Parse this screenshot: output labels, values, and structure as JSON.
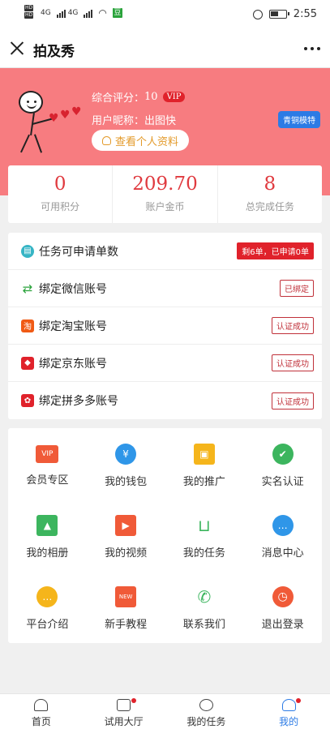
{
  "status_bar": {
    "time": "2:55",
    "hd1": "HD",
    "hd2": "HD",
    "net1": "4G",
    "net2": "4G",
    "app_icon": "豆"
  },
  "title_bar": {
    "title": "拍及秀"
  },
  "profile": {
    "score_label": "综合评分：",
    "score_value": "10",
    "vip_badge": "VIP",
    "nickname_label": "用户昵称：",
    "nickname_value": "出图快",
    "view_profile_label": "查看个人资料",
    "level_badge": "青铜模特"
  },
  "stats": [
    {
      "value": "0",
      "label": "可用积分"
    },
    {
      "value": "209.70",
      "label": "账户金币"
    },
    {
      "value": "8",
      "label": "总完成任务"
    }
  ],
  "accounts": [
    {
      "label": "任务可申请单数",
      "tag": "剩6单，已申请0单",
      "icon": "clipboard-icon",
      "color": "#36b5c5"
    },
    {
      "label": "绑定微信账号",
      "tag": "已绑定",
      "icon": "swap-arrows-icon",
      "color": "#2aa33b"
    },
    {
      "label": "绑定淘宝账号",
      "tag": "认证成功",
      "icon": "taobao-icon",
      "color": "#f05a14"
    },
    {
      "label": "绑定京东账号",
      "tag": "认证成功",
      "icon": "jd-icon",
      "color": "#e0222b"
    },
    {
      "label": "绑定拼多多账号",
      "tag": "认证成功",
      "icon": "pinduoduo-icon",
      "color": "#e0222b"
    }
  ],
  "menu": [
    {
      "label": "会员专区",
      "icon": "vip-icon",
      "glyph": "VIP",
      "color": "#f05a38"
    },
    {
      "label": "我的钱包",
      "icon": "yuan-icon",
      "glyph": "¥",
      "color": "#2f96e8"
    },
    {
      "label": "我的推广",
      "icon": "gift-icon",
      "glyph": "▣",
      "color": "#f5b51b"
    },
    {
      "label": "实名认证",
      "icon": "verified-icon",
      "glyph": "✔",
      "color": "#3cb55e"
    },
    {
      "label": "我的相册",
      "icon": "image-icon",
      "glyph": "▲",
      "color": "#3cb55e"
    },
    {
      "label": "我的视频",
      "icon": "video-icon",
      "glyph": "▶",
      "color": "#f05a38"
    },
    {
      "label": "我的任务",
      "icon": "cart-icon",
      "glyph": "🛒",
      "color": "#3cb55e"
    },
    {
      "label": "消息中心",
      "icon": "chat-icon",
      "glyph": "…",
      "color": "#2f96e8"
    },
    {
      "label": "平台介绍",
      "icon": "ellipsis-icon",
      "glyph": "…",
      "color": "#f5b51b"
    },
    {
      "label": "新手教程",
      "icon": "new-icon",
      "glyph": "NEW",
      "color": "#f05a38"
    },
    {
      "label": "联系我们",
      "icon": "phone-icon",
      "glyph": "✆",
      "color": "#3cb55e"
    },
    {
      "label": "退出登录",
      "icon": "clock-icon",
      "glyph": "◷",
      "color": "#f05a38"
    }
  ],
  "tabbar": [
    {
      "label": "首页"
    },
    {
      "label": "试用大厅"
    },
    {
      "label": "我的任务"
    },
    {
      "label": "我的"
    }
  ]
}
